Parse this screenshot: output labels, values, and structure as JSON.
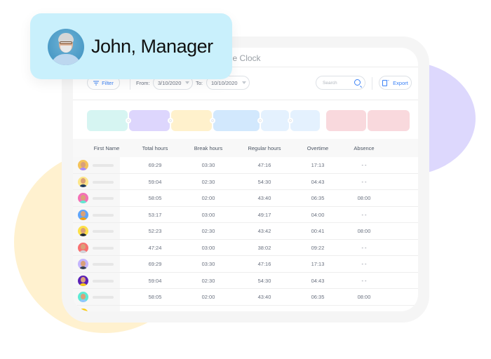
{
  "profile": {
    "name": "John, Manager"
  },
  "app": {
    "title": "Time Clock"
  },
  "toolbar": {
    "filter_label": "Filter",
    "from_label": "From:",
    "from_value": "3/10/2020",
    "to_label": "To:",
    "to_value": "10/10/2020",
    "search_placeholder": "Search",
    "export_label": "Export"
  },
  "timeline": {
    "segments": [
      {
        "color": "#d6f5f2"
      },
      {
        "color": "#ddd6fd"
      },
      {
        "color": "#fff1cc"
      },
      {
        "color": "#d2e8fd"
      },
      {
        "color": "#e4f1fe"
      },
      {
        "color": "#e4f1fe"
      },
      {
        "color": "#f9d9dd"
      },
      {
        "color": "#f9d9dd"
      }
    ]
  },
  "table": {
    "columns": [
      "First Name",
      "Total hours",
      "Break hours",
      "Regular hours",
      "Overtime",
      "Absence"
    ],
    "rows": [
      {
        "avatar_bg": "#f4c35a",
        "shirt": "#a78bfa",
        "total": "69:29",
        "break": "03:30",
        "regular": "47:16",
        "overtime": "17:13",
        "absence": "- -"
      },
      {
        "avatar_bg": "#fde68a",
        "shirt": "#1f3a5f",
        "total": "59:04",
        "break": "02:30",
        "regular": "54:30",
        "overtime": "04:43",
        "absence": "- -"
      },
      {
        "avatar_bg": "#f472b6",
        "shirt": "#5eead4",
        "total": "58:05",
        "break": "02:00",
        "regular": "43:40",
        "overtime": "06:35",
        "absence": "08:00"
      },
      {
        "avatar_bg": "#60a5fa",
        "shirt": "#f59e0b",
        "total": "53:17",
        "break": "03:00",
        "regular": "49:17",
        "overtime": "04:00",
        "absence": "- -"
      },
      {
        "avatar_bg": "#fde047",
        "shirt": "#1f2937",
        "total": "52:23",
        "break": "02:30",
        "regular": "43:42",
        "overtime": "00:41",
        "absence": "08:00"
      },
      {
        "avatar_bg": "#f87171",
        "shirt": "#d1d5db",
        "total": "47:24",
        "break": "03:00",
        "regular": "38:02",
        "overtime": "09:22",
        "absence": "- -"
      },
      {
        "avatar_bg": "#c4b5fd",
        "shirt": "#374151",
        "total": "69:29",
        "break": "03:30",
        "regular": "47:16",
        "overtime": "17:13",
        "absence": "- -"
      },
      {
        "avatar_bg": "#5b21b6",
        "shirt": "#facc15",
        "total": "59:04",
        "break": "02:30",
        "regular": "54:30",
        "overtime": "04:43",
        "absence": "- -"
      },
      {
        "avatar_bg": "#5eead4",
        "shirt": "#93c5fd",
        "total": "58:05",
        "break": "02:00",
        "regular": "43:40",
        "overtime": "06:35",
        "absence": "08:00"
      },
      {
        "avatar_bg": "#facc15",
        "shirt": "#1f2937",
        "total": "",
        "break": "",
        "regular": "",
        "overtime": "",
        "absence": ""
      }
    ]
  }
}
